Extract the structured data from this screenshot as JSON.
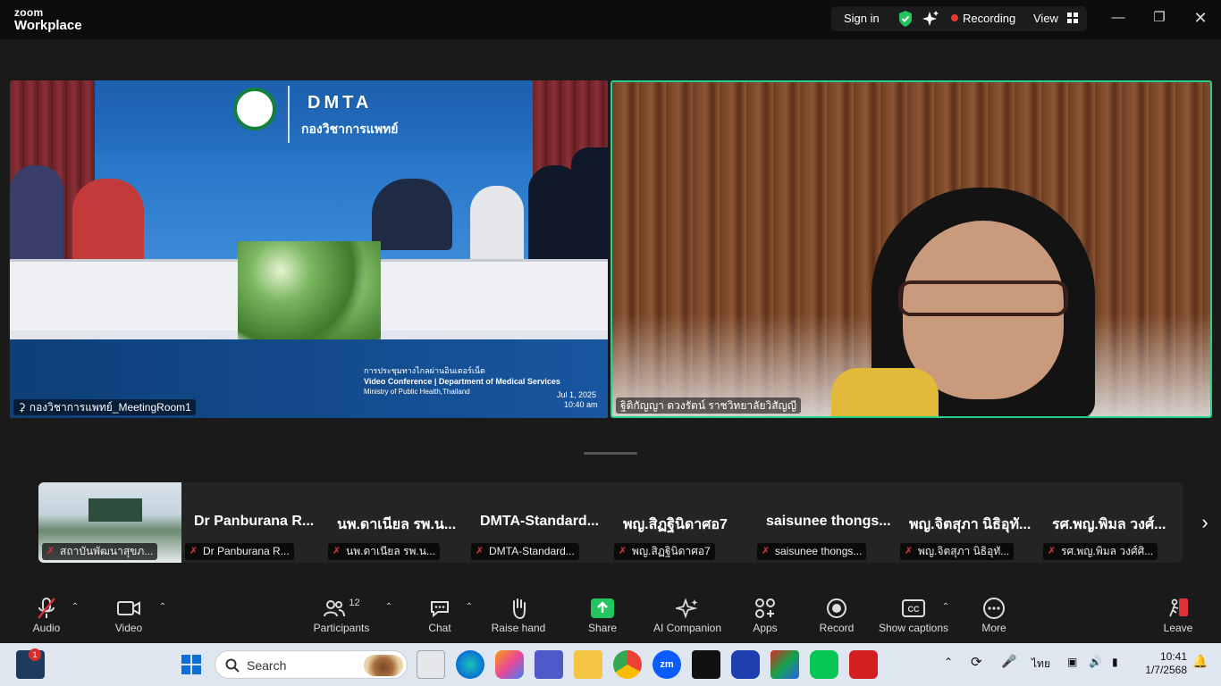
{
  "app": {
    "brand_line1": "zoom",
    "brand_line2": "Workplace"
  },
  "titlebar": {
    "sign_in": "Sign in",
    "recording": "Recording",
    "view": "View"
  },
  "colors": {
    "recording_dot": "#e53935",
    "shield": "#22c55e",
    "active_speaker": "#23d18b",
    "share_green": "#22c55e",
    "muted": "#e0303a"
  },
  "main": {
    "tile_left": {
      "name": "กองวิชาการแพทย์_MeetingRoom1",
      "title_thai": "กองวิชาการแพทย์",
      "logo_text": "DMTA",
      "caption_thai": "การประชุมทางไกลผ่านอินเตอร์เน็ต",
      "caption_en": "Video Conference | Department of Medical Services",
      "caption_en2": "Ministry of Public Health,Thailand",
      "date": "Jul 1, 2025",
      "time": "10:40 am"
    },
    "tile_right": {
      "name": "ฐิติกัญญา ดวงรัตน์ ราชวิทยาลัยวิสัญญี"
    }
  },
  "strip": {
    "items": [
      {
        "big": "",
        "small": "สถาบันพัฒนาสุขภ..."
      },
      {
        "big": "Dr Panburana R...",
        "small": "Dr Panburana R..."
      },
      {
        "big": "นพ.ดาเนียล รพ.น...",
        "small": "นพ.ดาเนียล รพ.น..."
      },
      {
        "big": "DMTA-Standard...",
        "small": "DMTA-Standard..."
      },
      {
        "big": "พญ.สิฏฐินิดาศอ7",
        "small": "พญ.สิฏฐินิดาศอ7"
      },
      {
        "big": "saisunee thongs...",
        "small": "saisunee thongs..."
      },
      {
        "big": "พญ.จิตสุภา นิธิอุทั...",
        "small": "พญ.จิตสุภา นิธิอุทั..."
      },
      {
        "big": "รศ.พญ.พิมล วงศ์...",
        "small": "รศ.พญ.พิมล วงศ์ศิ..."
      }
    ]
  },
  "toolbar": {
    "audio": "Audio",
    "video": "Video",
    "participants": "Participants",
    "participants_count": "12",
    "chat": "Chat",
    "raise_hand": "Raise hand",
    "share": "Share",
    "ai": "AI Companion",
    "apps": "Apps",
    "record": "Record",
    "captions": "Show captions",
    "more": "More",
    "leave": "Leave"
  },
  "taskbar": {
    "search_placeholder": "Search",
    "notif_badge": "1",
    "lang": "ไทย",
    "time": "10:41",
    "date": "1/7/2568"
  }
}
